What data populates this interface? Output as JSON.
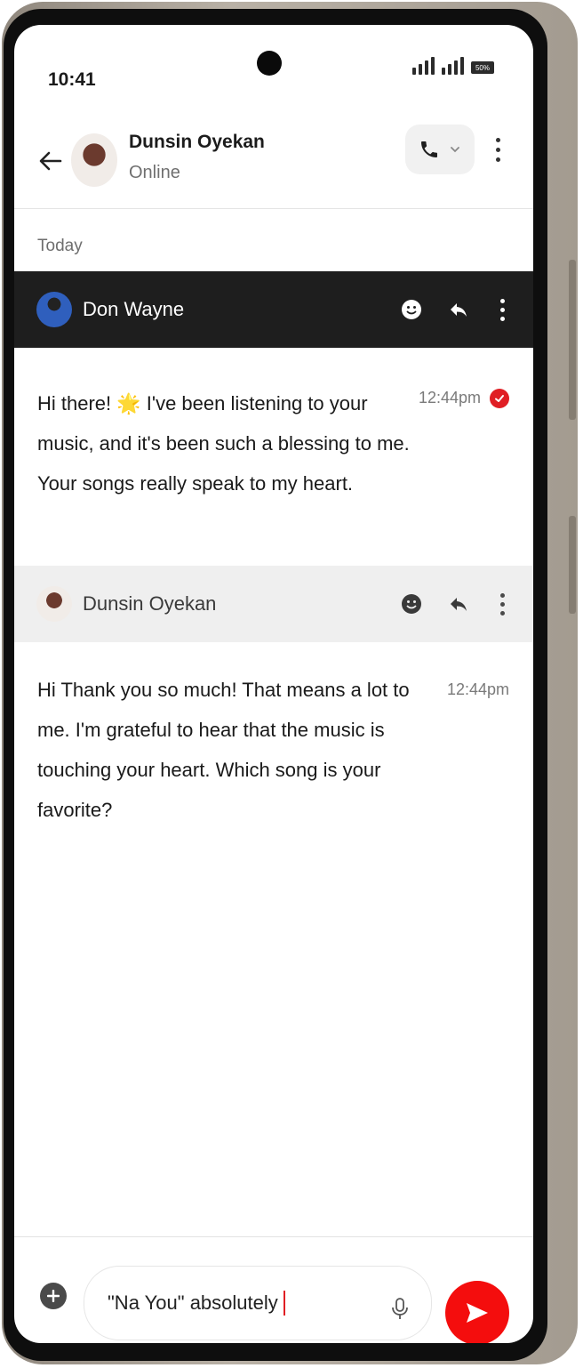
{
  "status_bar": {
    "time": "10:41",
    "battery": "50%"
  },
  "header": {
    "contact_name": "Dunsin Oyekan",
    "contact_status": "Online",
    "icons": [
      "arrow-left-icon",
      "phone-icon",
      "chevron-down-icon",
      "more-vertical-icon"
    ]
  },
  "conversation": {
    "day_label": "Today",
    "messages": [
      {
        "sender": "Don Wayne",
        "text": "Hi there! 🌟 I've been listening to your music, and it's been such a blessing to me. Your songs really speak to my heart.",
        "time": "12:44pm",
        "read": true
      },
      {
        "sender": "Dunsin Oyekan",
        "text": "Hi Thank you so much! That means a lot to me. I'm grateful to hear that the music is touching your heart. Which song is your favorite?",
        "time": "12:44pm"
      }
    ],
    "message_actions": [
      "emoji-react-icon",
      "reply-icon",
      "more-vertical-icon"
    ]
  },
  "composer": {
    "value": "\"Na You\" absolutely",
    "icons": [
      "plus-icon",
      "microphone-icon",
      "send-icon"
    ]
  },
  "colors": {
    "accent_red": "#f40d0d",
    "dark_bar": "#1e1e1e",
    "light_bar": "#efefef"
  }
}
